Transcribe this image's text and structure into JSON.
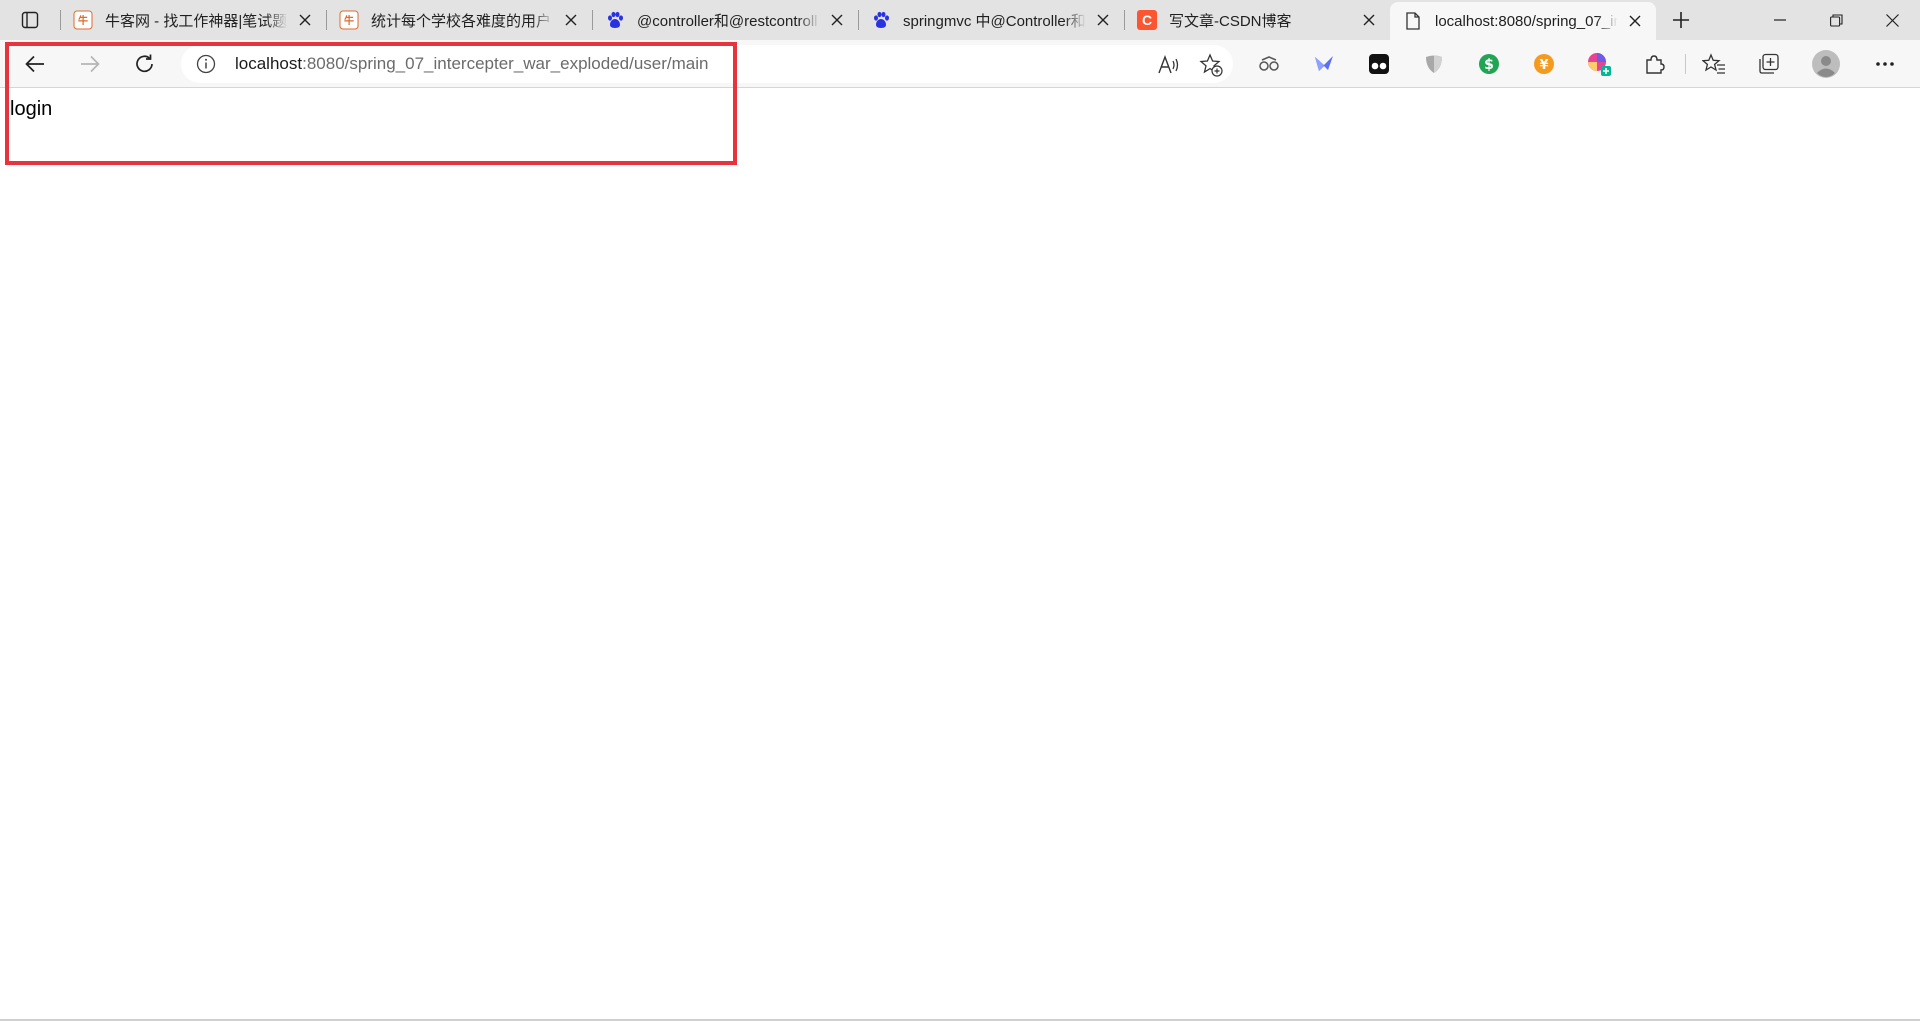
{
  "browser": {
    "tabs": [
      {
        "title": "牛客网 - 找工作神器|笔试题",
        "favicon": "nowcoder-icon",
        "active": false
      },
      {
        "title": "统计每个学校各难度的用户",
        "favicon": "nowcoder-icon",
        "active": false
      },
      {
        "title": "@controller和@restcontroll",
        "favicon": "baidu-paw-icon",
        "active": false
      },
      {
        "title": "springmvc 中@Controller和",
        "favicon": "baidu-paw-icon",
        "active": false
      },
      {
        "title": "写文章-CSDN博客",
        "favicon": "csdn-icon",
        "active": false
      },
      {
        "title": "localhost:8080/spring_07_in",
        "favicon": "page-icon",
        "active": true
      }
    ],
    "address_bar": {
      "host": "localhost",
      "rest": ":8080/spring_07_intercepter_war_exploded/user/main"
    },
    "colors": {
      "highlight": "#e8323c",
      "tabstrip": "#e3e3e3",
      "toolbar": "#f7f7f7"
    }
  },
  "page": {
    "body_text": "login"
  }
}
